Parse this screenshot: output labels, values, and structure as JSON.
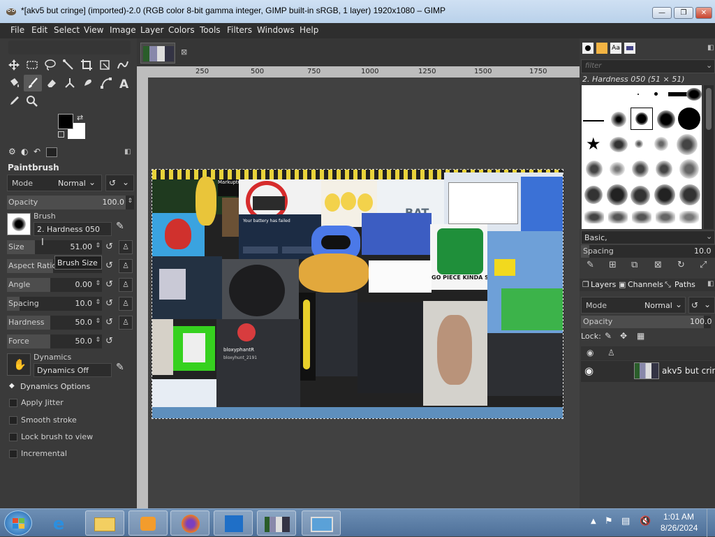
{
  "window": {
    "title": "*[akv5 but cringe] (imported)-2.0 (RGB color 8-bit gamma integer, GIMP built-in sRGB, 1 layer) 1920x1080 – GIMP",
    "minimize": "—",
    "maximize": "❐",
    "close": "✕"
  },
  "menubar": [
    "File",
    "Edit",
    "Select",
    "View",
    "Image",
    "Layer",
    "Colors",
    "Tools",
    "Filters",
    "Windows",
    "Help"
  ],
  "toolbox": {
    "tools": [
      "move-tool",
      "rect-select-tool",
      "free-select-tool",
      "fuzzy-select-tool",
      "crop-tool",
      "transform-tool",
      "warp-tool",
      "bucket-fill-tool",
      "paintbrush-tool",
      "eraser-tool",
      "clone-tool",
      "smudge-tool",
      "path-tool",
      "text-tool",
      "color-picker-tool",
      "zoom-tool"
    ],
    "fg_color": "#000000",
    "bg_color": "#ffffff"
  },
  "tool_options": {
    "title": "Paintbrush",
    "mode_label": "Mode",
    "mode_value": "Normal",
    "opacity_label": "Opacity",
    "opacity_value": "100.0",
    "brush_label": "Brush",
    "brush_value": "2. Hardness 050",
    "size_label": "Size",
    "size_value": "51.00",
    "aspect_label": "Aspect Ratio",
    "aspect_tooltip": "Brush Size",
    "angle_label": "Angle",
    "angle_value": "0.00",
    "spacing_label": "Spacing",
    "spacing_value": "10.0",
    "hardness_label": "Hardness",
    "hardness_value": "50.0",
    "force_label": "Force",
    "force_value": "50.0",
    "dynamics_label": "Dynamics",
    "dynamics_value": "Dynamics Off",
    "dynamics_options": "Dynamics Options",
    "apply_jitter": "Apply Jitter",
    "smooth_stroke": "Smooth stroke",
    "lock_brush": "Lock brush to view",
    "incremental": "Incremental"
  },
  "ruler": {
    "ticks": [
      "250",
      "500",
      "750",
      "1000",
      "1250",
      "1500",
      "1750"
    ]
  },
  "image_collage": {
    "texts": [
      "BAT",
      "GO PIECE KINDA SUS",
      "bloxyphantR",
      "bloxyhunt_2191",
      "Your battery has failed",
      "Diamonds",
      "Markuptu"
    ]
  },
  "brushes_panel": {
    "filter_placeholder": "filter",
    "selected_brush": "2. Hardness 050 (51 × 51)",
    "tag_value": "Basic,",
    "spacing_label": "Spacing",
    "spacing_value": "10.0"
  },
  "layers_panel": {
    "tabs": [
      "Layers",
      "Channels",
      "Paths"
    ],
    "mode_label": "Mode",
    "mode_value": "Normal",
    "opacity_label": "Opacity",
    "opacity_value": "100.0",
    "lock_label": "Lock:",
    "layer_name": "akv5 but cringe"
  },
  "taskbar": {
    "time": "1:01 AM",
    "date": "8/26/2024"
  }
}
